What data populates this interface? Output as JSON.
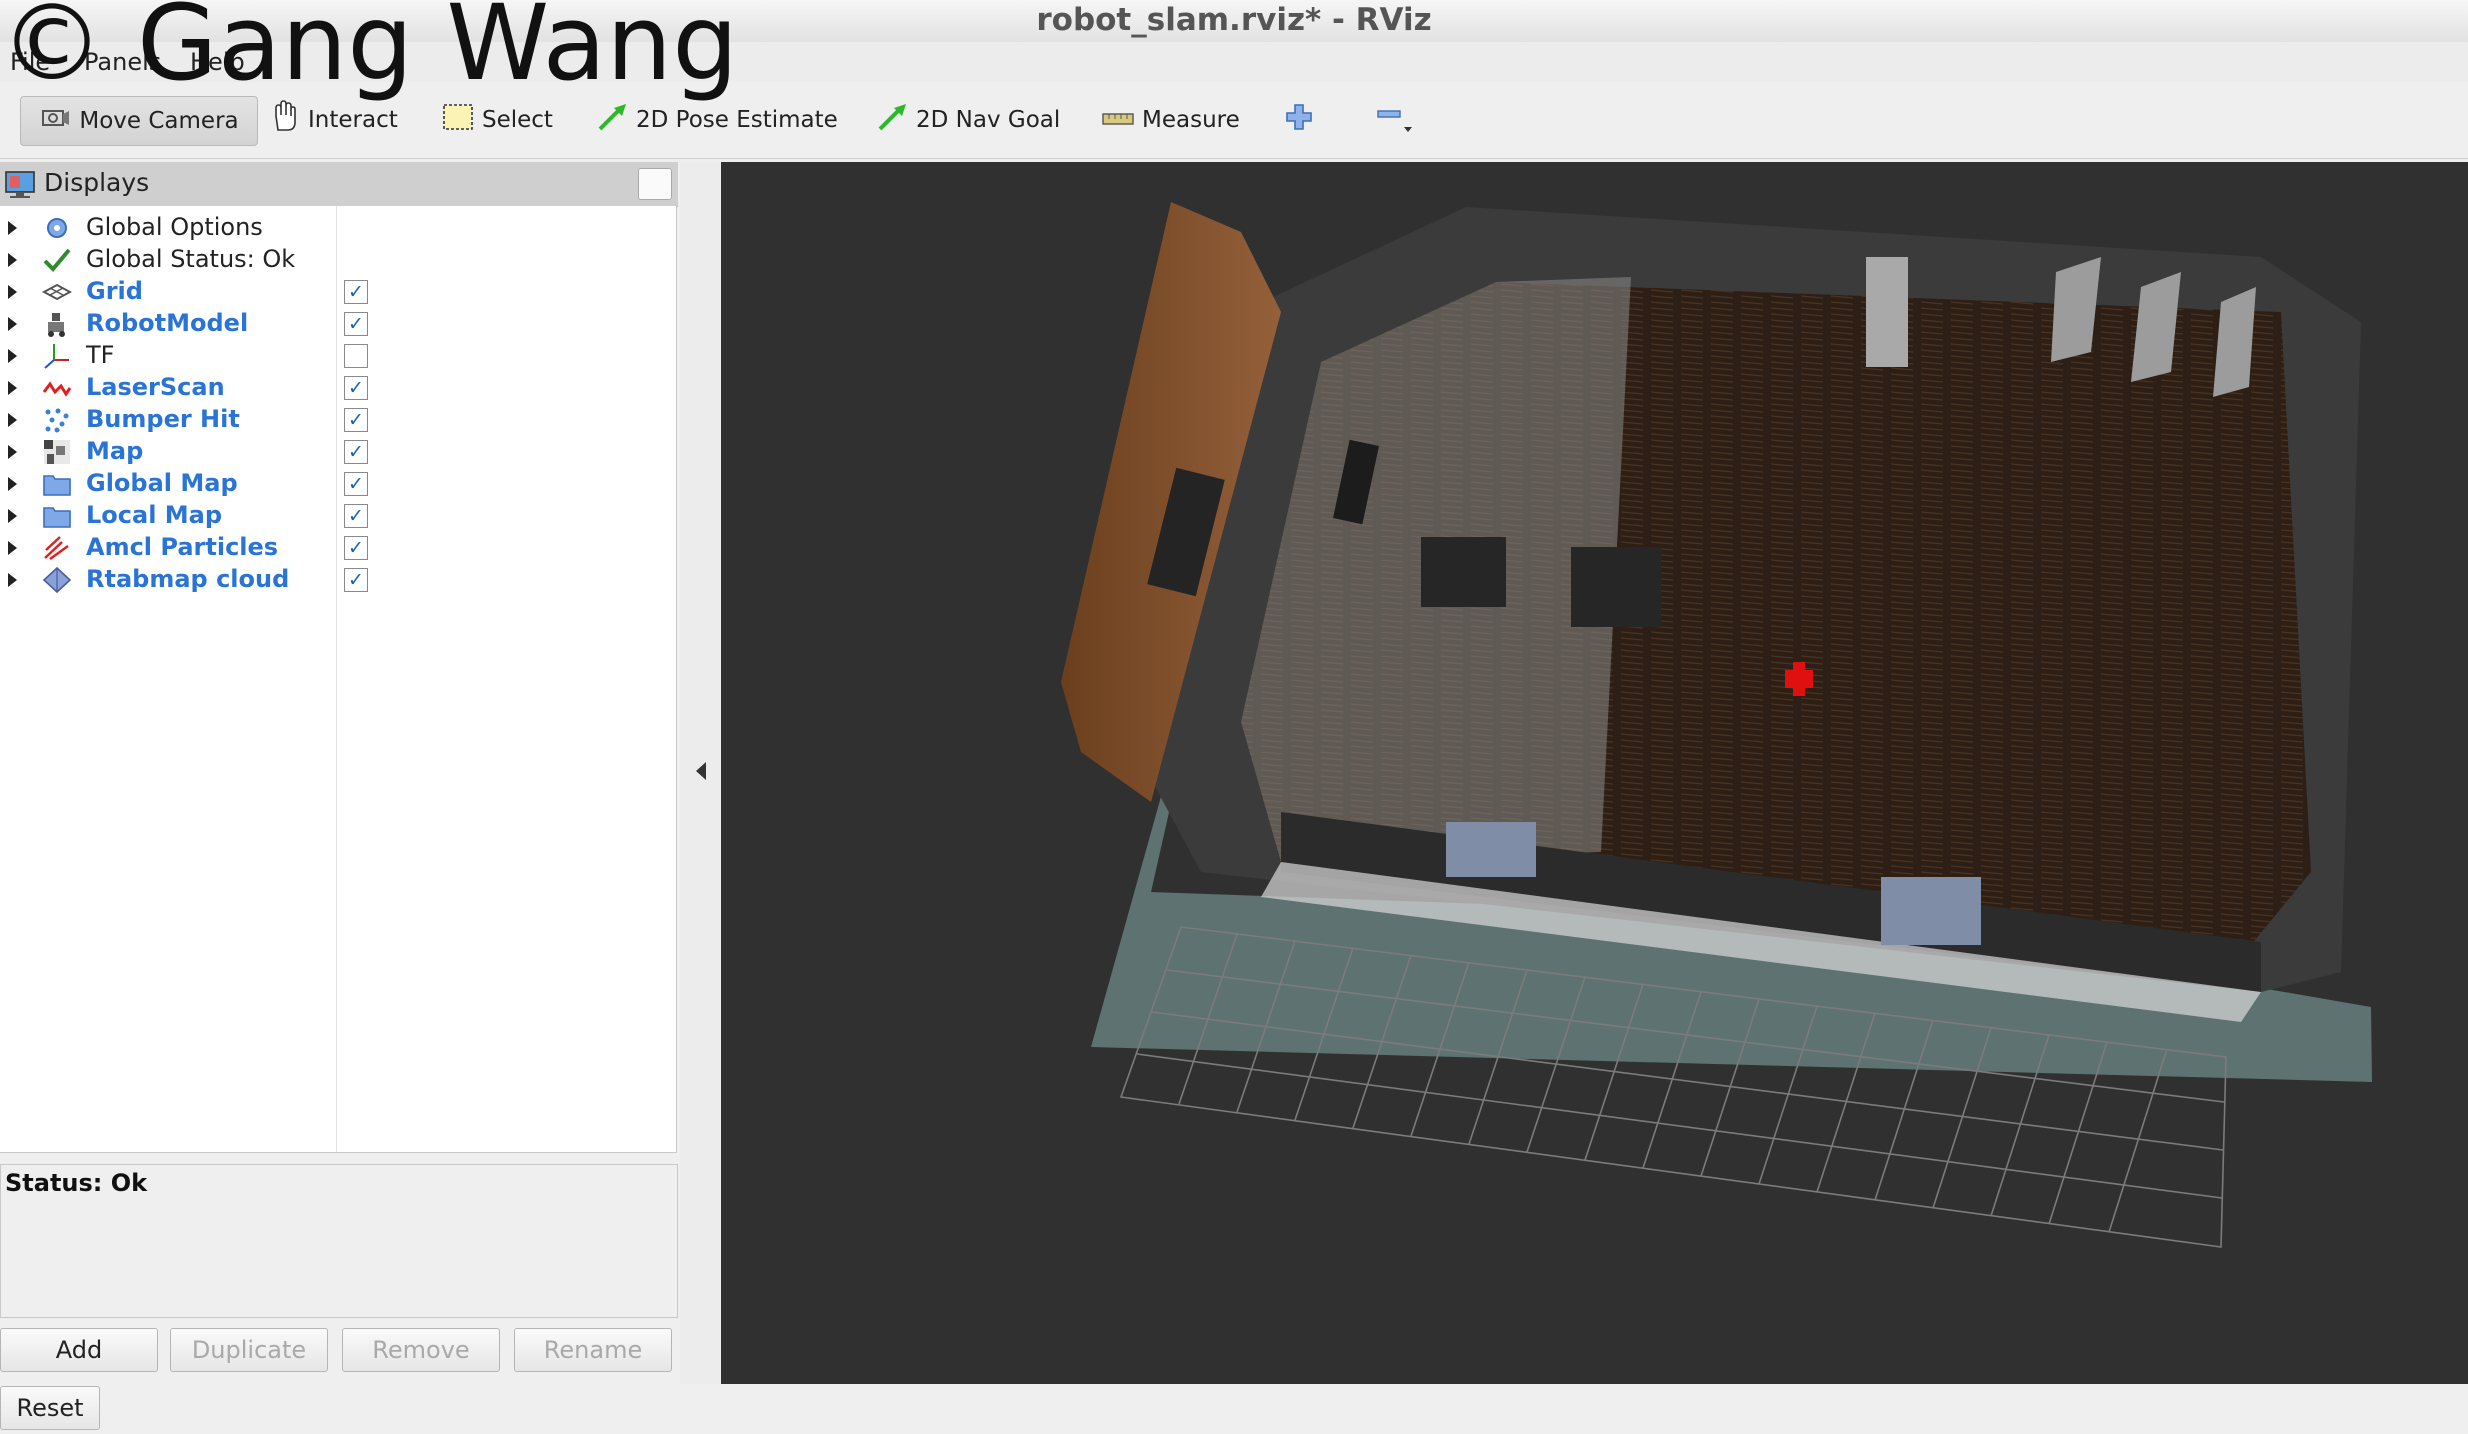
{
  "window": {
    "title": "robot_slam.rviz* - RViz"
  },
  "watermark": "© Gang Wang",
  "menubar": {
    "items": [
      "File",
      "Panels",
      "Help"
    ]
  },
  "toolbar": {
    "move_camera": "Move Camera",
    "interact": "Interact",
    "select": "Select",
    "pose_estimate": "2D Pose Estimate",
    "nav_goal": "2D Nav Goal",
    "measure": "Measure"
  },
  "displays": {
    "title": "Displays",
    "items": [
      {
        "label": "Global Options",
        "icon": "gear-icon",
        "enabled": false,
        "checkbox": false,
        "checked": false
      },
      {
        "label": "Global Status: Ok",
        "icon": "check-icon",
        "enabled": false,
        "checkbox": false,
        "checked": false
      },
      {
        "label": "Grid",
        "icon": "grid-icon",
        "enabled": true,
        "checkbox": true,
        "checked": true
      },
      {
        "label": "RobotModel",
        "icon": "robot-icon",
        "enabled": true,
        "checkbox": true,
        "checked": true
      },
      {
        "label": "TF",
        "icon": "axes-icon",
        "enabled": false,
        "checkbox": true,
        "checked": false
      },
      {
        "label": "LaserScan",
        "icon": "laser-icon",
        "enabled": true,
        "checkbox": true,
        "checked": true
      },
      {
        "label": "Bumper Hit",
        "icon": "points-icon",
        "enabled": true,
        "checkbox": true,
        "checked": true
      },
      {
        "label": "Map",
        "icon": "map-icon",
        "enabled": true,
        "checkbox": true,
        "checked": true
      },
      {
        "label": "Global Map",
        "icon": "folder-icon",
        "enabled": true,
        "checkbox": true,
        "checked": true
      },
      {
        "label": "Local Map",
        "icon": "folder-icon",
        "enabled": true,
        "checkbox": true,
        "checked": true
      },
      {
        "label": "Amcl Particles",
        "icon": "particles-icon",
        "enabled": true,
        "checkbox": true,
        "checked": true
      },
      {
        "label": "Rtabmap cloud",
        "icon": "cloud-icon",
        "enabled": true,
        "checkbox": true,
        "checked": true
      }
    ]
  },
  "status": {
    "text": "Status: Ok"
  },
  "panel_buttons": {
    "add": "Add",
    "duplicate": "Duplicate",
    "remove": "Remove",
    "rename": "Rename",
    "reset": "Reset"
  },
  "colors": {
    "enabled_label": "#2a74d6",
    "viewport_bg": "#303030",
    "robot": "#e01010"
  }
}
